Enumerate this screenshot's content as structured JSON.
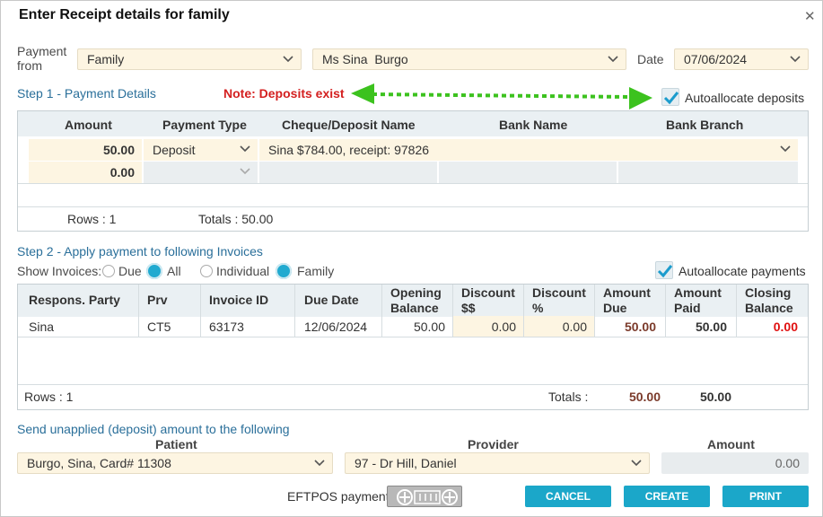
{
  "dialog": {
    "title": "Enter Receipt details for family"
  },
  "payment_from": {
    "label": "Payment from",
    "source": "Family",
    "person": "Ms Sina  Burgo",
    "date_label": "Date",
    "date": "07/06/2024"
  },
  "step1": {
    "title": "Step 1 - Payment Details",
    "note": "Note: Deposits exist",
    "autoallocate_label": "Autoallocate deposits",
    "columns": [
      "Amount",
      "Payment Type",
      "Cheque/Deposit Name",
      "Bank Name",
      "Bank Branch"
    ],
    "row1": {
      "amount": "50.00",
      "type": "Deposit",
      "deposit_name": "Sina $784.00, receipt: 97826"
    },
    "row2": {
      "amount": "0.00"
    },
    "rows_text": "Rows : 1",
    "totals_text": "Totals : 50.00"
  },
  "step2": {
    "title": "Step 2 - Apply payment to following Invoices",
    "show_label": "Show Invoices:",
    "filter1": [
      "Due",
      "All"
    ],
    "filter2": [
      "Individual",
      "Family"
    ],
    "autoallocate_label": "Autoallocate payments",
    "columns": {
      "party": "Respons. Party",
      "prv": "Prv",
      "invoice": "Invoice ID",
      "due": "Due Date",
      "opening_1": "Opening",
      "opening_2": "Balance",
      "disc_1": "Discount",
      "disc_2": "$$",
      "discp_1": "Discount",
      "discp_2": "%",
      "amtdue_1": "Amount",
      "amtdue_2": "Due",
      "amtpaid_1": "Amount",
      "amtpaid_2": "Paid",
      "closing_1": "Closing",
      "closing_2": "Balance"
    },
    "row": {
      "party": "Sina",
      "prv": "CT5",
      "invoice": "63173",
      "due": "12/06/2024",
      "opening": "50.00",
      "disc": "0.00",
      "discp": "0.00",
      "amtdue": "50.00",
      "amtpaid": "50.00",
      "closing": "0.00"
    },
    "rows_text": "Rows : 1",
    "totals_label": "Totals :",
    "total_due": "50.00",
    "total_paid": "50.00"
  },
  "unapplied": {
    "title": "Send unapplied (deposit) amount to the following",
    "patient_label": "Patient",
    "patient": "Burgo, Sina, Card# 11308",
    "provider_label": "Provider",
    "provider": "97 - Dr Hill, Daniel",
    "amount_label": "Amount",
    "amount": "0.00"
  },
  "footer": {
    "eftpos_label": "EFTPOS payment",
    "cancel": "CANCEL",
    "create": "CREATE",
    "print": "PRINT"
  },
  "colors": {
    "accent": "#1ba7c9",
    "note": "#d42020",
    "arrow": "#3cc21e",
    "field": "#fdf5e2"
  }
}
